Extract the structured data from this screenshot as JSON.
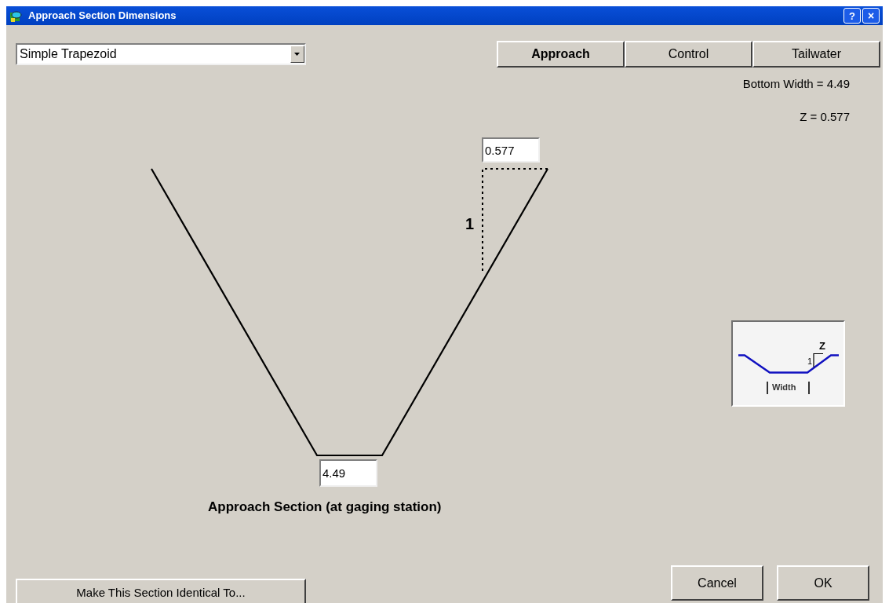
{
  "window": {
    "title": "Approach Section Dimensions",
    "title_buttons": [
      "?",
      "×"
    ]
  },
  "shape_dropdown": {
    "value": "Simple Trapezoid"
  },
  "section_tabs": [
    {
      "label": "Approach",
      "selected": true
    },
    {
      "label": "Control",
      "selected": false
    },
    {
      "label": "Tailwater",
      "selected": false
    }
  ],
  "readouts": [
    "Bottom Width = 4.49",
    "Z = 0.577"
  ],
  "diagram": {
    "slope_input": "0.577",
    "rise_label": "1",
    "width_input": "4.49",
    "caption": "Approach Section (at gaging station)"
  },
  "legend": {
    "z_label": "Z",
    "rise_label": "1",
    "width_label": "Width"
  },
  "buttons": [
    "Make This Section Identical To...",
    "Cancel",
    "OK"
  ]
}
